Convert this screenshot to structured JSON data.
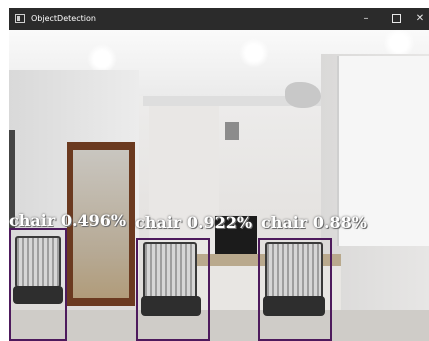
{
  "window": {
    "title": "ObjectDetection",
    "app_icon": "window-app-icon",
    "controls": {
      "minimize": "–",
      "close": "✕"
    }
  },
  "detections": [
    {
      "label": "chair 0.496%",
      "class": "chair",
      "score_text": "0.496%"
    },
    {
      "label": "chair 0.922%",
      "class": "chair",
      "score_text": "0.922%"
    },
    {
      "label": "chair 0.88%",
      "class": "chair",
      "score_text": "0.88%"
    }
  ],
  "colors": {
    "titlebar": "#2b2b2b",
    "bbox": "#4d1a5c",
    "label_text": "#ffffff"
  }
}
